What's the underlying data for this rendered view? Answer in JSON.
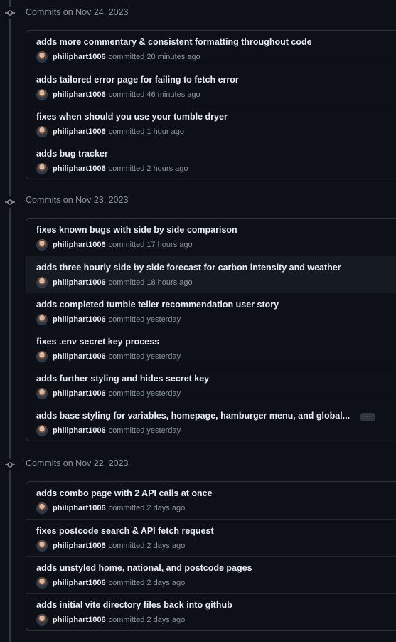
{
  "groups": [
    {
      "title": "Commits on Nov 24, 2023",
      "commits": [
        {
          "message": "adds more commentary & consistent formatting throughout code",
          "author": "philiphart1006",
          "action": "committed",
          "time": "20 minutes ago"
        },
        {
          "message": "adds tailored error page for failing to fetch error",
          "author": "philiphart1006",
          "action": "committed",
          "time": "46 minutes ago"
        },
        {
          "message": "fixes when should you use your tumble dryer",
          "author": "philiphart1006",
          "action": "committed",
          "time": "1 hour ago"
        },
        {
          "message": "adds bug tracker",
          "author": "philiphart1006",
          "action": "committed",
          "time": "2 hours ago"
        }
      ]
    },
    {
      "title": "Commits on Nov 23, 2023",
      "commits": [
        {
          "message": "fixes known bugs with side by side comparison",
          "author": "philiphart1006",
          "action": "committed",
          "time": "17 hours ago"
        },
        {
          "message": "adds three hourly side by side forecast for carbon intensity and weather",
          "author": "philiphart1006",
          "action": "committed",
          "time": "18 hours ago"
        },
        {
          "message": "adds completed tumble teller recommendation user story",
          "author": "philiphart1006",
          "action": "committed",
          "time": "yesterday"
        },
        {
          "message": "fixes .env secret key process",
          "author": "philiphart1006",
          "action": "committed",
          "time": "yesterday"
        },
        {
          "message": "adds further styling and hides secret key",
          "author": "philiphart1006",
          "action": "committed",
          "time": "yesterday"
        },
        {
          "message": "adds base styling for variables, homepage, hamburger menu, and global...",
          "author": "philiphart1006",
          "action": "committed",
          "time": "yesterday",
          "more_label": "⋯"
        }
      ]
    },
    {
      "title": "Commits on Nov 22, 2023",
      "commits": [
        {
          "message": "adds combo page with 2 API calls at once",
          "author": "philiphart1006",
          "action": "committed",
          "time": "2 days ago"
        },
        {
          "message": "fixes postcode search & API fetch request",
          "author": "philiphart1006",
          "action": "committed",
          "time": "2 days ago"
        },
        {
          "message": "adds unstyled home, national, and postcode pages",
          "author": "philiphart1006",
          "action": "committed",
          "time": "2 days ago"
        },
        {
          "message": "adds initial vite directory files back into github",
          "author": "philiphart1006",
          "action": "committed",
          "time": "2 days ago"
        }
      ]
    }
  ]
}
